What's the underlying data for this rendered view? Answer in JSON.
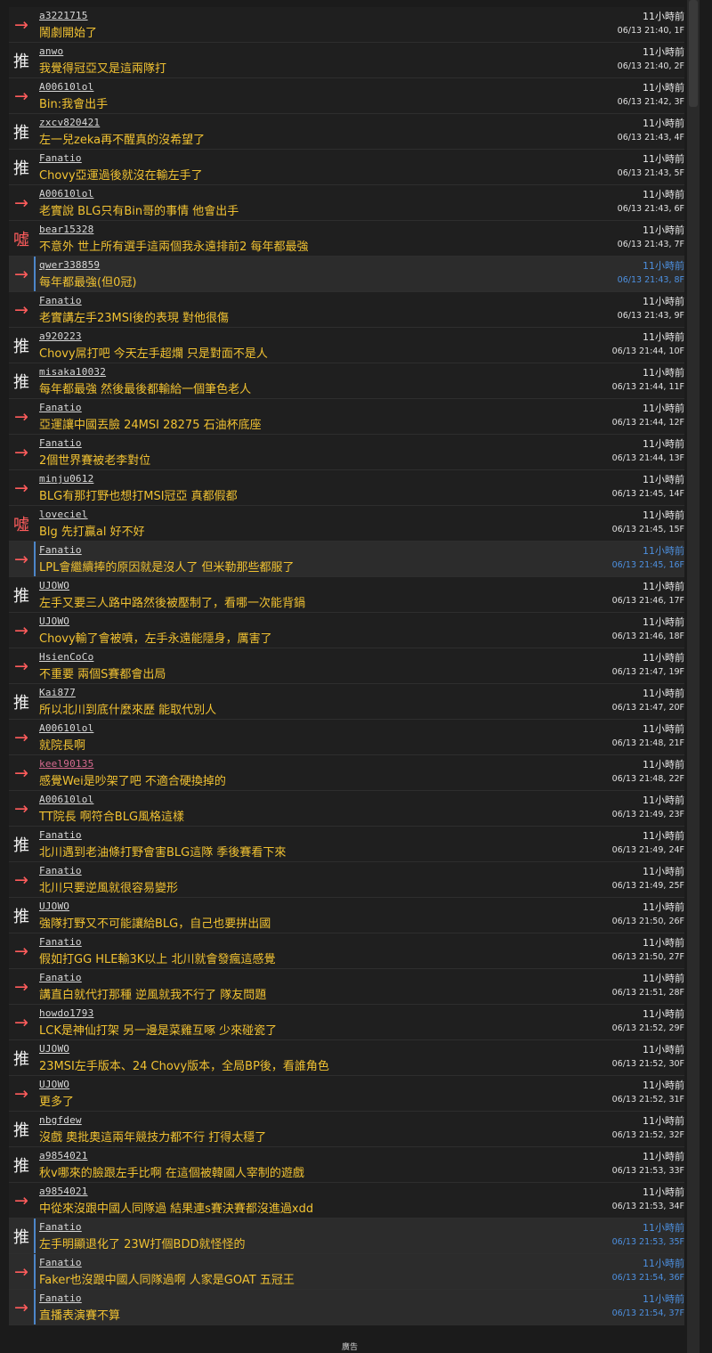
{
  "pushes": [
    {
      "tag": "→",
      "type": "arrow",
      "userid": "a3221715",
      "content": "鬧劇開始了",
      "ago": "11小時前",
      "ipdatetime": "06/13 21:40, 1F"
    },
    {
      "tag": "推",
      "type": "push",
      "userid": "anwo",
      "content": "我覺得冠亞又是這兩隊打",
      "ago": "11小時前",
      "ipdatetime": "06/13 21:40, 2F"
    },
    {
      "tag": "→",
      "type": "arrow",
      "userid": "A00610lol",
      "content": "Bin:我會出手",
      "ago": "11小時前",
      "ipdatetime": "06/13 21:42, 3F"
    },
    {
      "tag": "推",
      "type": "push",
      "userid": "zxcv820421",
      "content": "左一兒zeka再不醒真的沒希望了",
      "ago": "11小時前",
      "ipdatetime": "06/13 21:43, 4F"
    },
    {
      "tag": "推",
      "type": "push",
      "userid": "Fanatio",
      "content": "Chovy亞運過後就沒在輸左手了",
      "ago": "11小時前",
      "ipdatetime": "06/13 21:43, 5F"
    },
    {
      "tag": "→",
      "type": "arrow",
      "userid": "A00610lol",
      "content": "老實說 BLG只有Bin哥的事情 他會出手",
      "ago": "11小時前",
      "ipdatetime": "06/13 21:43, 6F"
    },
    {
      "tag": "噓",
      "type": "boo",
      "userid": "bear15328",
      "content": "不意外 世上所有選手這兩個我永遠排前2 每年都最強",
      "ago": "11小時前",
      "ipdatetime": "06/13 21:43, 7F"
    },
    {
      "tag": "→",
      "type": "arrow",
      "userid": "qwer338859",
      "content": "每年都最強(但0冠)",
      "ago": "11小時前",
      "ipdatetime": "06/13 21:43, 8F",
      "highlight": true
    },
    {
      "tag": "→",
      "type": "arrow",
      "userid": "Fanatio",
      "content": "老實講左手23MSI後的表現 對他很傷",
      "ago": "11小時前",
      "ipdatetime": "06/13 21:43, 9F"
    },
    {
      "tag": "推",
      "type": "push",
      "userid": "a920223",
      "content": "Chovy屌打吧 今天左手超爛 只是對面不是人",
      "ago": "11小時前",
      "ipdatetime": "06/13 21:44, 10F"
    },
    {
      "tag": "推",
      "type": "push",
      "userid": "misaka10032",
      "content": "每年都最強 然後最後都輸給一個筆色老人",
      "ago": "11小時前",
      "ipdatetime": "06/13 21:44, 11F"
    },
    {
      "tag": "→",
      "type": "arrow",
      "userid": "Fanatio",
      "content": "亞運讓中國丟臉 24MSI 28275 石油杯底座",
      "ago": "11小時前",
      "ipdatetime": "06/13 21:44, 12F"
    },
    {
      "tag": "→",
      "type": "arrow",
      "userid": "Fanatio",
      "content": "2個世界賽被老李對位",
      "ago": "11小時前",
      "ipdatetime": "06/13 21:44, 13F"
    },
    {
      "tag": "→",
      "type": "arrow",
      "userid": "minju0612",
      "content": "BLG有那打野也想打MSI冠亞 真都假都",
      "ago": "11小時前",
      "ipdatetime": "06/13 21:45, 14F"
    },
    {
      "tag": "噓",
      "type": "boo",
      "userid": "loveciel",
      "content": "Blg 先打贏al 好不好",
      "ago": "11小時前",
      "ipdatetime": "06/13 21:45, 15F"
    },
    {
      "tag": "→",
      "type": "arrow",
      "userid": "Fanatio",
      "content": "LPL會繼續捧的原因就是沒人了 但米勒那些都服了",
      "ago": "11小時前",
      "ipdatetime": "06/13 21:45, 16F",
      "highlight": true
    },
    {
      "tag": "推",
      "type": "push",
      "userid": "UJOWO",
      "content": "左手又要三人路中路然後被壓制了，看哪一次能背鍋",
      "ago": "11小時前",
      "ipdatetime": "06/13 21:46, 17F"
    },
    {
      "tag": "→",
      "type": "arrow",
      "userid": "UJOWO",
      "content": "Chovy輸了會被噴，左手永遠能隱身，厲害了",
      "ago": "11小時前",
      "ipdatetime": "06/13 21:46, 18F"
    },
    {
      "tag": "→",
      "type": "arrow",
      "userid": "HsienCoCo",
      "content": "不重要 兩個S賽都會出局",
      "ago": "11小時前",
      "ipdatetime": "06/13 21:47, 19F"
    },
    {
      "tag": "推",
      "type": "push",
      "userid": "Kai877",
      "content": "所以北川到底什麼來歷 能取代別人",
      "ago": "11小時前",
      "ipdatetime": "06/13 21:47, 20F"
    },
    {
      "tag": "→",
      "type": "arrow",
      "userid": "A00610lol",
      "content": "就院長啊",
      "ago": "11小時前",
      "ipdatetime": "06/13 21:48, 21F"
    },
    {
      "tag": "→",
      "type": "arrow",
      "userid": "keel90135",
      "content": "感覺Wei是吵架了吧 不適合硬換掉的",
      "ago": "11小時前",
      "ipdatetime": "06/13 21:48, 22F",
      "pinkid": true
    },
    {
      "tag": "→",
      "type": "arrow",
      "userid": "A00610lol",
      "content": "TT院長 啊符合BLG風格這樣",
      "ago": "11小時前",
      "ipdatetime": "06/13 21:49, 23F"
    },
    {
      "tag": "推",
      "type": "push",
      "userid": "Fanatio",
      "content": "北川遇到老油條打野會害BLG這隊 季後賽看下來",
      "ago": "11小時前",
      "ipdatetime": "06/13 21:49, 24F"
    },
    {
      "tag": "→",
      "type": "arrow",
      "userid": "Fanatio",
      "content": "北川只要逆風就很容易變形",
      "ago": "11小時前",
      "ipdatetime": "06/13 21:49, 25F"
    },
    {
      "tag": "推",
      "type": "push",
      "userid": "UJOWO",
      "content": "強隊打野又不可能讓給BLG，自己也要拼出國",
      "ago": "11小時前",
      "ipdatetime": "06/13 21:50, 26F"
    },
    {
      "tag": "→",
      "type": "arrow",
      "userid": "Fanatio",
      "content": "假如打GG HLE輸3K以上 北川就會發瘋這感覺",
      "ago": "11小時前",
      "ipdatetime": "06/13 21:50, 27F"
    },
    {
      "tag": "→",
      "type": "arrow",
      "userid": "Fanatio",
      "content": "講直白就代打那種 逆風就我不行了 隊友問題",
      "ago": "11小時前",
      "ipdatetime": "06/13 21:51, 28F"
    },
    {
      "tag": "→",
      "type": "arrow",
      "userid": "howdo1793",
      "content": "LCK是神仙打架 另一邊是菜雞互啄 少來碰瓷了",
      "ago": "11小時前",
      "ipdatetime": "06/13 21:52, 29F"
    },
    {
      "tag": "推",
      "type": "push",
      "userid": "UJOWO",
      "content": "23MSI左手版本、24 Chovy版本，全局BP後，看誰角色",
      "ago": "11小時前",
      "ipdatetime": "06/13 21:52, 30F"
    },
    {
      "tag": "→",
      "type": "arrow",
      "userid": "UJOWO",
      "content": "更多了",
      "ago": "11小時前",
      "ipdatetime": "06/13 21:52, 31F"
    },
    {
      "tag": "推",
      "type": "push",
      "userid": "nbgfdew",
      "content": "沒戲 奧批奧這兩年競技力都不行 打得太穩了",
      "ago": "11小時前",
      "ipdatetime": "06/13 21:52, 32F"
    },
    {
      "tag": "推",
      "type": "push",
      "userid": "a9854021",
      "content": "秋v哪來的臉跟左手比啊 在這個被韓國人宰制的遊戲",
      "ago": "11小時前",
      "ipdatetime": "06/13 21:53, 33F"
    },
    {
      "tag": "→",
      "type": "arrow",
      "userid": "a9854021",
      "content": "中從來沒跟中國人同隊過 結果連s賽決賽都沒進過xdd",
      "ago": "11小時前",
      "ipdatetime": "06/13 21:53, 34F"
    },
    {
      "tag": "推",
      "type": "push",
      "userid": "Fanatio",
      "content": "左手明顯退化了 23W打個BDD就怪怪的",
      "ago": "11小時前",
      "ipdatetime": "06/13 21:53, 35F",
      "highlight": true
    },
    {
      "tag": "→",
      "type": "arrow",
      "userid": "Fanatio",
      "content": "Faker也沒跟中國人同隊過啊 人家是GOAT 五冠王",
      "ago": "11小時前",
      "ipdatetime": "06/13 21:54, 36F",
      "highlight": true
    },
    {
      "tag": "→",
      "type": "arrow",
      "userid": "Fanatio",
      "content": "直播表演賽不算",
      "ago": "11小時前",
      "ipdatetime": "06/13 21:54, 37F",
      "highlight": true
    }
  ],
  "footer": {
    "label": "廣告"
  }
}
